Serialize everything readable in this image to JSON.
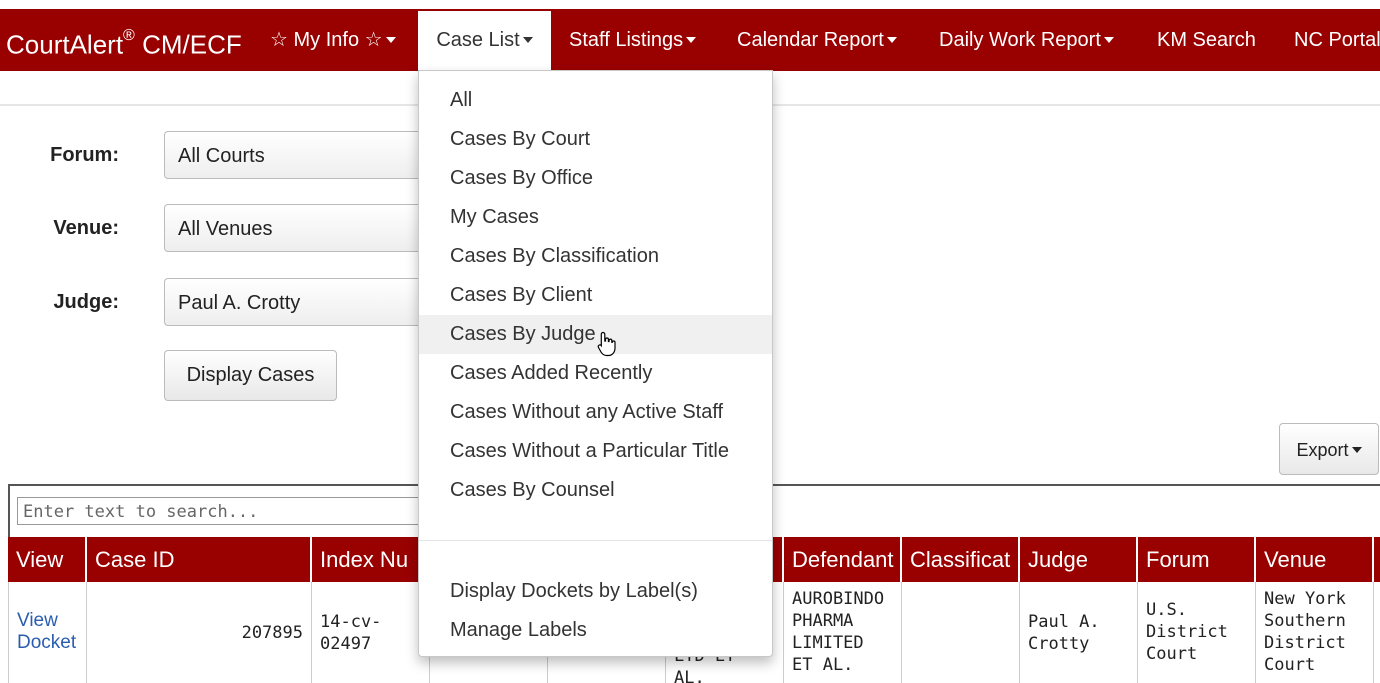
{
  "nav": {
    "brand": "CourtAlert",
    "brand_reg": "®",
    "brand_suffix": " CM/ECF",
    "items": [
      {
        "label": "☆ My Info ☆"
      },
      {
        "label": "Case List"
      },
      {
        "label": "Staff Listings"
      },
      {
        "label": "Calendar Report"
      },
      {
        "label": "Daily Work Report"
      },
      {
        "label": "KM Search"
      },
      {
        "label": "NC Portal"
      }
    ]
  },
  "form": {
    "forum_label": "Forum:",
    "forum_value": "All Courts",
    "venue_label": "Venue:",
    "venue_value": "All Venues",
    "judge_label": "Judge:",
    "judge_value": "Paul A. Crotty",
    "display_button": "Display Cases"
  },
  "export_button": "Export",
  "search": {
    "placeholder": "Enter text to search..."
  },
  "table": {
    "headers": [
      "View",
      "Case ID",
      "Index Nu",
      "",
      "",
      "",
      "Defendant",
      "Classificat",
      "Judge",
      "Forum",
      "Venue"
    ],
    "row": {
      "view": "View Docket",
      "case_id": "207895",
      "index_number": "14-cv-02497",
      "partial_text": "LTD ET AL.",
      "defendant": "AUROBINDO PHARMA LIMITED ET AL.",
      "classification": "",
      "judge": "Paul A. Crotty",
      "forum": "U.S. District Court",
      "venue": "New York Southern District Court"
    }
  },
  "dropdown": {
    "items": [
      "All",
      "Cases By Court",
      "Cases By Office",
      "My Cases",
      "Cases By Classification",
      "Cases By Client",
      "Cases By Judge",
      "Cases Added Recently",
      "Cases Without any Active Staff",
      "Cases Without a Particular Title",
      "Cases By Counsel"
    ],
    "label_items": [
      "Display Dockets by Label(s)",
      "Manage Labels"
    ],
    "hovered": "Cases By Judge"
  },
  "colors": {
    "brand": "#990000",
    "link": "#2a5db0"
  }
}
